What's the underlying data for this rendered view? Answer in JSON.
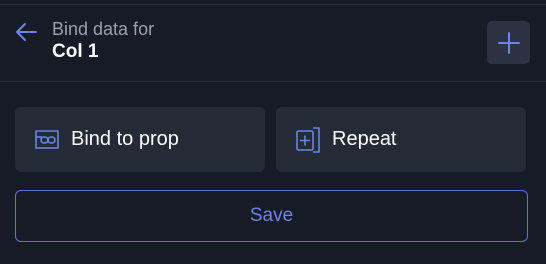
{
  "colors": {
    "background": "#171b26",
    "card": "#252a37",
    "accent": "#6b84ea",
    "muted_text": "#9aa0b0"
  },
  "header": {
    "subtitle": "Bind data for",
    "title": "Col 1",
    "back_icon": "arrow-left-icon",
    "add_icon": "plus-icon"
  },
  "actions": [
    {
      "label": "Bind to prop",
      "icon": "link-box-icon"
    },
    {
      "label": "Repeat",
      "icon": "repeat-plus-icon"
    }
  ],
  "footer": {
    "save_label": "Save"
  }
}
